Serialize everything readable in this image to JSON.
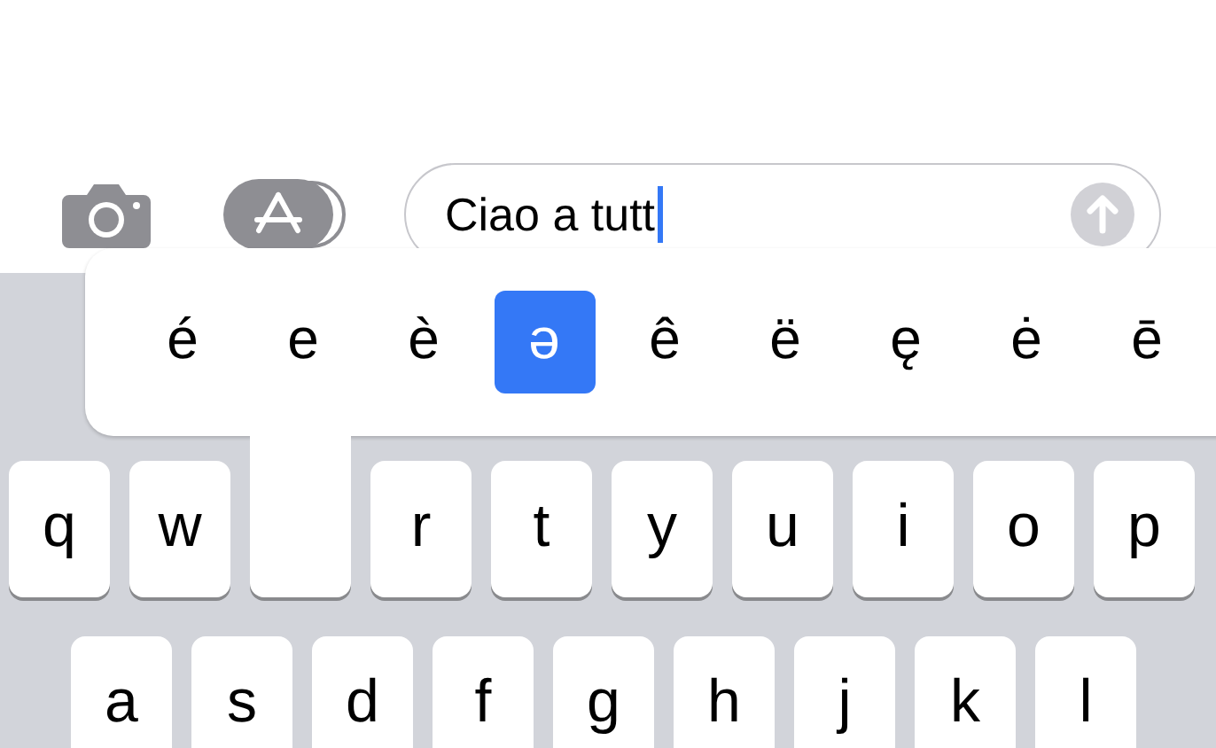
{
  "message_bar": {
    "value": "Ciao a tutt"
  },
  "accent_popup": {
    "options": [
      {
        "label": "é",
        "selected": false
      },
      {
        "label": "e",
        "selected": false
      },
      {
        "label": "è",
        "selected": false
      },
      {
        "label": "ə",
        "selected": true
      },
      {
        "label": "ê",
        "selected": false
      },
      {
        "label": "ë",
        "selected": false
      },
      {
        "label": "ę",
        "selected": false
      },
      {
        "label": "ė",
        "selected": false
      },
      {
        "label": "ē",
        "selected": false
      }
    ]
  },
  "keyboard": {
    "rows": [
      {
        "keys": [
          {
            "kind": "key",
            "label": "q"
          },
          {
            "kind": "key",
            "label": "w"
          },
          {
            "kind": "pressed"
          },
          {
            "kind": "key",
            "label": "r"
          },
          {
            "kind": "key",
            "label": "t"
          },
          {
            "kind": "key",
            "label": "y"
          },
          {
            "kind": "key",
            "label": "u"
          },
          {
            "kind": "key",
            "label": "i"
          },
          {
            "kind": "key",
            "label": "o"
          },
          {
            "kind": "key",
            "label": "p"
          }
        ]
      },
      {
        "keys": [
          {
            "kind": "key",
            "label": "a"
          },
          {
            "kind": "key",
            "label": "s"
          },
          {
            "kind": "key",
            "label": "d"
          },
          {
            "kind": "key",
            "label": "f"
          },
          {
            "kind": "key",
            "label": "g"
          },
          {
            "kind": "key",
            "label": "h"
          },
          {
            "kind": "key",
            "label": "j"
          },
          {
            "kind": "key",
            "label": "k"
          },
          {
            "kind": "key",
            "label": "l"
          }
        ]
      }
    ]
  }
}
